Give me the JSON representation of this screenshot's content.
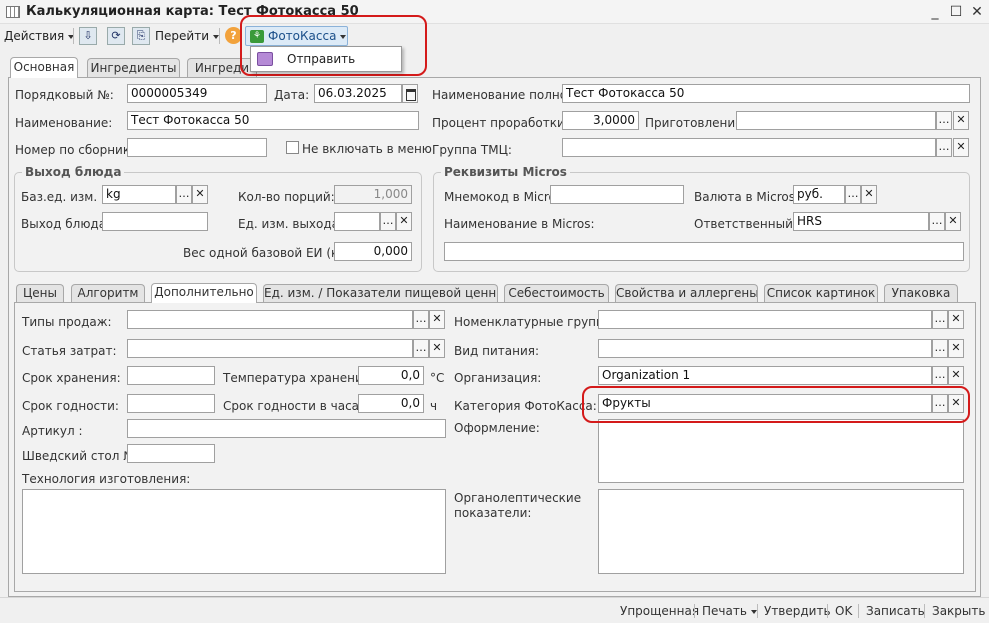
{
  "window": {
    "title": "Калькуляционная карта: Тест Фотокасса 50",
    "minimize": "_",
    "maximize": "☐",
    "close": "✕"
  },
  "toolbar": {
    "actions_label": "Действия",
    "goto_label": "Перейти",
    "help_label": "?",
    "fotokassa_label": "ФотоКасса",
    "dropdown_item": "Отправить"
  },
  "tabs": [
    "Основная",
    "Ингредиенты",
    "Ингреди"
  ],
  "main": {
    "order_no_label": "Порядковый №:",
    "order_no_value": "0000005349",
    "date_label": "Дата:",
    "date_value": "06.03.2025",
    "fullname_label": "Наименование полное:",
    "fullname_value": "Тест Фотокасса 50",
    "name_label": "Наименование:",
    "name_value": "Тест Фотокасса 50",
    "percent_label": "Процент проработки:",
    "percent_value": "3,0000",
    "prep_label": "Приготовление:",
    "prep_value": "",
    "collection_label": "Номер по сборнику:",
    "collection_value": "",
    "exclude_menu_label": "Не включать в меню",
    "tmc_label": "Группа ТМЦ:",
    "tmc_value": ""
  },
  "output_group": {
    "title": "Выход блюда",
    "base_unit_label": "Баз.ед. изм.",
    "base_unit_value": "kg",
    "portions_label": "Кол-во порций:",
    "portions_value": "1,000",
    "output_label": "Выход блюда:",
    "output_value": "",
    "output_unit_label": "Ед. изм. выхода:",
    "output_unit_value": "",
    "weight_label": "Вес одной базовой ЕИ (кг):",
    "weight_value": "0,000"
  },
  "micros_group": {
    "title": "Реквизиты Micros",
    "mnemo_label": "Мнемокод в Micros:",
    "mnemo_value": "",
    "currency_label": "Валюта в Micros:",
    "currency_value": "руб.",
    "name_label": "Наименование в Micros:",
    "name_value": "",
    "responsible_label": "Ответственный:",
    "responsible_value": "HRS",
    "extra_value": ""
  },
  "subtabs": [
    "Цены",
    "Алгоритм",
    "Дополнительно",
    "Ед. изм. / Показатели пищевой ценн...",
    "Себестоимость",
    "Свойства и аллергены",
    "Список картинок",
    "Упаковка"
  ],
  "extra": {
    "sale_types_label": "Типы продаж:",
    "cost_item_label": "Статья затрат:",
    "storage_label": "Срок хранения:",
    "storage_temp_label": "Температура хранения:",
    "storage_temp_value": "0,0",
    "temp_unit": "°C",
    "shelf_label": "Срок годности:",
    "shelf_hours_label": "Срок годности в часах:",
    "shelf_hours_value": "0,0",
    "hours_unit": "ч",
    "article_label": "Артикул :",
    "swedish_label": "Шведский стол №:",
    "tech_label": "Технология изготовления:",
    "nomen_label": "Номенклатурные группы:",
    "food_type_label": "Вид питания:",
    "org_label": "Организация:",
    "org_value": "Organization 1",
    "category_label": "Категория ФотоКасса:",
    "category_value": "Фрукты",
    "design_label": "Оформление:",
    "organoleptic_label": "Органолептические показатели:"
  },
  "bottom": {
    "simplified": "Упрощенная",
    "print": "Печать",
    "approve": "Утвердить",
    "ok": "OK",
    "save": "Записать",
    "close": "Закрыть"
  },
  "colors": {
    "highlight": "#d41a1a",
    "fotokassa_bg": "#dceaf7"
  }
}
